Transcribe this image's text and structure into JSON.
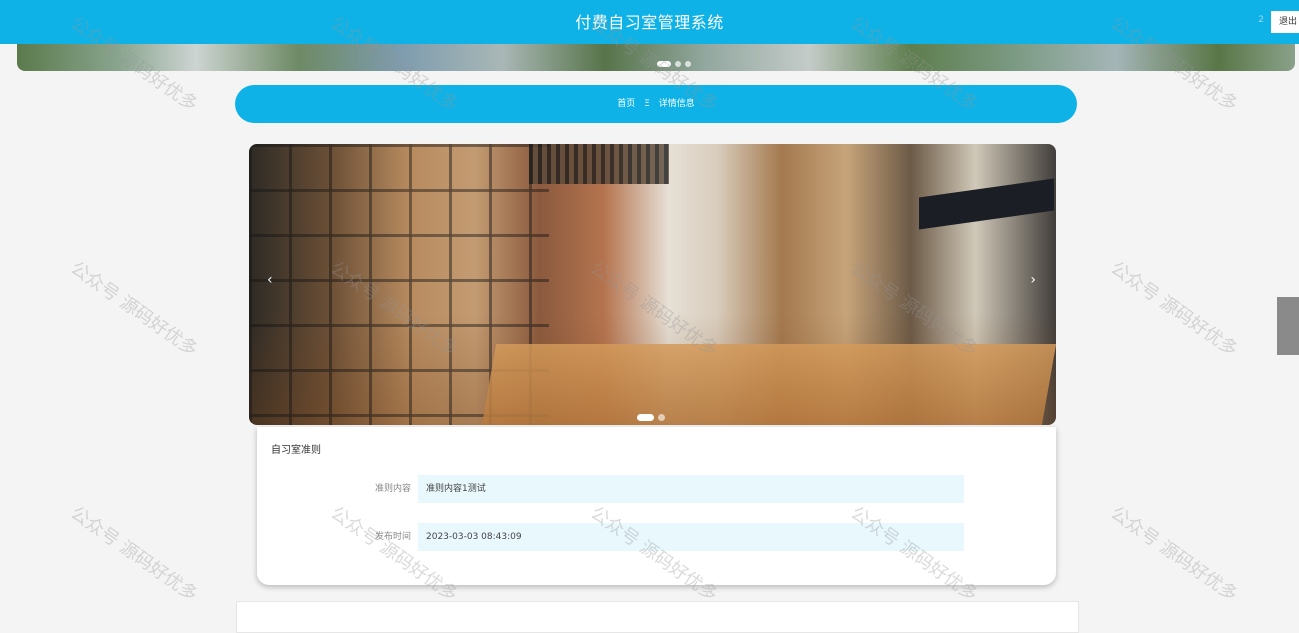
{
  "header": {
    "title": "付费自习室管理系统",
    "user": "2",
    "logout_label": "退出"
  },
  "breadcrumb": {
    "home": "首页",
    "separator": "Ξ",
    "current": "详情信息"
  },
  "carousel": {
    "prev_label": "‹",
    "next_label": "›",
    "slide_count": 2,
    "active_slide": 1
  },
  "detail": {
    "heading": "自习室准则",
    "fields": [
      {
        "label": "准则内容",
        "value": "准则内容1测试"
      },
      {
        "label": "发布时间",
        "value": "2023-03-03 08:43:09"
      }
    ]
  },
  "watermark": "公众号 源码好优多",
  "colors": {
    "accent": "#0fb2e6",
    "field_bg": "#e8f8fd",
    "page_bg": "#f4f4f4"
  }
}
